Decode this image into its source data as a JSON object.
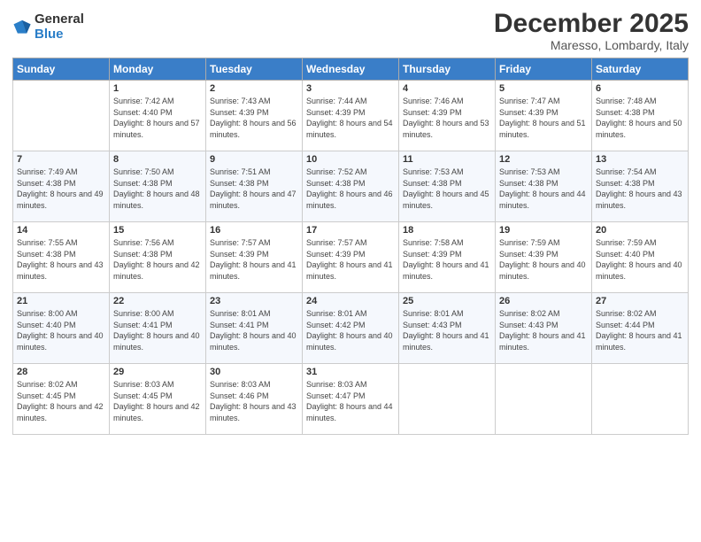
{
  "logo": {
    "general": "General",
    "blue": "Blue"
  },
  "header": {
    "month": "December 2025",
    "location": "Maresso, Lombardy, Italy"
  },
  "weekdays": [
    "Sunday",
    "Monday",
    "Tuesday",
    "Wednesday",
    "Thursday",
    "Friday",
    "Saturday"
  ],
  "weeks": [
    [
      {
        "day": "",
        "sunrise": "",
        "sunset": "",
        "daylight": ""
      },
      {
        "day": "1",
        "sunrise": "Sunrise: 7:42 AM",
        "sunset": "Sunset: 4:40 PM",
        "daylight": "Daylight: 8 hours and 57 minutes."
      },
      {
        "day": "2",
        "sunrise": "Sunrise: 7:43 AM",
        "sunset": "Sunset: 4:39 PM",
        "daylight": "Daylight: 8 hours and 56 minutes."
      },
      {
        "day": "3",
        "sunrise": "Sunrise: 7:44 AM",
        "sunset": "Sunset: 4:39 PM",
        "daylight": "Daylight: 8 hours and 54 minutes."
      },
      {
        "day": "4",
        "sunrise": "Sunrise: 7:46 AM",
        "sunset": "Sunset: 4:39 PM",
        "daylight": "Daylight: 8 hours and 53 minutes."
      },
      {
        "day": "5",
        "sunrise": "Sunrise: 7:47 AM",
        "sunset": "Sunset: 4:39 PM",
        "daylight": "Daylight: 8 hours and 51 minutes."
      },
      {
        "day": "6",
        "sunrise": "Sunrise: 7:48 AM",
        "sunset": "Sunset: 4:38 PM",
        "daylight": "Daylight: 8 hours and 50 minutes."
      }
    ],
    [
      {
        "day": "7",
        "sunrise": "Sunrise: 7:49 AM",
        "sunset": "Sunset: 4:38 PM",
        "daylight": "Daylight: 8 hours and 49 minutes."
      },
      {
        "day": "8",
        "sunrise": "Sunrise: 7:50 AM",
        "sunset": "Sunset: 4:38 PM",
        "daylight": "Daylight: 8 hours and 48 minutes."
      },
      {
        "day": "9",
        "sunrise": "Sunrise: 7:51 AM",
        "sunset": "Sunset: 4:38 PM",
        "daylight": "Daylight: 8 hours and 47 minutes."
      },
      {
        "day": "10",
        "sunrise": "Sunrise: 7:52 AM",
        "sunset": "Sunset: 4:38 PM",
        "daylight": "Daylight: 8 hours and 46 minutes."
      },
      {
        "day": "11",
        "sunrise": "Sunrise: 7:53 AM",
        "sunset": "Sunset: 4:38 PM",
        "daylight": "Daylight: 8 hours and 45 minutes."
      },
      {
        "day": "12",
        "sunrise": "Sunrise: 7:53 AM",
        "sunset": "Sunset: 4:38 PM",
        "daylight": "Daylight: 8 hours and 44 minutes."
      },
      {
        "day": "13",
        "sunrise": "Sunrise: 7:54 AM",
        "sunset": "Sunset: 4:38 PM",
        "daylight": "Daylight: 8 hours and 43 minutes."
      }
    ],
    [
      {
        "day": "14",
        "sunrise": "Sunrise: 7:55 AM",
        "sunset": "Sunset: 4:38 PM",
        "daylight": "Daylight: 8 hours and 43 minutes."
      },
      {
        "day": "15",
        "sunrise": "Sunrise: 7:56 AM",
        "sunset": "Sunset: 4:38 PM",
        "daylight": "Daylight: 8 hours and 42 minutes."
      },
      {
        "day": "16",
        "sunrise": "Sunrise: 7:57 AM",
        "sunset": "Sunset: 4:39 PM",
        "daylight": "Daylight: 8 hours and 41 minutes."
      },
      {
        "day": "17",
        "sunrise": "Sunrise: 7:57 AM",
        "sunset": "Sunset: 4:39 PM",
        "daylight": "Daylight: 8 hours and 41 minutes."
      },
      {
        "day": "18",
        "sunrise": "Sunrise: 7:58 AM",
        "sunset": "Sunset: 4:39 PM",
        "daylight": "Daylight: 8 hours and 41 minutes."
      },
      {
        "day": "19",
        "sunrise": "Sunrise: 7:59 AM",
        "sunset": "Sunset: 4:39 PM",
        "daylight": "Daylight: 8 hours and 40 minutes."
      },
      {
        "day": "20",
        "sunrise": "Sunrise: 7:59 AM",
        "sunset": "Sunset: 4:40 PM",
        "daylight": "Daylight: 8 hours and 40 minutes."
      }
    ],
    [
      {
        "day": "21",
        "sunrise": "Sunrise: 8:00 AM",
        "sunset": "Sunset: 4:40 PM",
        "daylight": "Daylight: 8 hours and 40 minutes."
      },
      {
        "day": "22",
        "sunrise": "Sunrise: 8:00 AM",
        "sunset": "Sunset: 4:41 PM",
        "daylight": "Daylight: 8 hours and 40 minutes."
      },
      {
        "day": "23",
        "sunrise": "Sunrise: 8:01 AM",
        "sunset": "Sunset: 4:41 PM",
        "daylight": "Daylight: 8 hours and 40 minutes."
      },
      {
        "day": "24",
        "sunrise": "Sunrise: 8:01 AM",
        "sunset": "Sunset: 4:42 PM",
        "daylight": "Daylight: 8 hours and 40 minutes."
      },
      {
        "day": "25",
        "sunrise": "Sunrise: 8:01 AM",
        "sunset": "Sunset: 4:43 PM",
        "daylight": "Daylight: 8 hours and 41 minutes."
      },
      {
        "day": "26",
        "sunrise": "Sunrise: 8:02 AM",
        "sunset": "Sunset: 4:43 PM",
        "daylight": "Daylight: 8 hours and 41 minutes."
      },
      {
        "day": "27",
        "sunrise": "Sunrise: 8:02 AM",
        "sunset": "Sunset: 4:44 PM",
        "daylight": "Daylight: 8 hours and 41 minutes."
      }
    ],
    [
      {
        "day": "28",
        "sunrise": "Sunrise: 8:02 AM",
        "sunset": "Sunset: 4:45 PM",
        "daylight": "Daylight: 8 hours and 42 minutes."
      },
      {
        "day": "29",
        "sunrise": "Sunrise: 8:03 AM",
        "sunset": "Sunset: 4:45 PM",
        "daylight": "Daylight: 8 hours and 42 minutes."
      },
      {
        "day": "30",
        "sunrise": "Sunrise: 8:03 AM",
        "sunset": "Sunset: 4:46 PM",
        "daylight": "Daylight: 8 hours and 43 minutes."
      },
      {
        "day": "31",
        "sunrise": "Sunrise: 8:03 AM",
        "sunset": "Sunset: 4:47 PM",
        "daylight": "Daylight: 8 hours and 44 minutes."
      },
      {
        "day": "",
        "sunrise": "",
        "sunset": "",
        "daylight": ""
      },
      {
        "day": "",
        "sunrise": "",
        "sunset": "",
        "daylight": ""
      },
      {
        "day": "",
        "sunrise": "",
        "sunset": "",
        "daylight": ""
      }
    ]
  ]
}
